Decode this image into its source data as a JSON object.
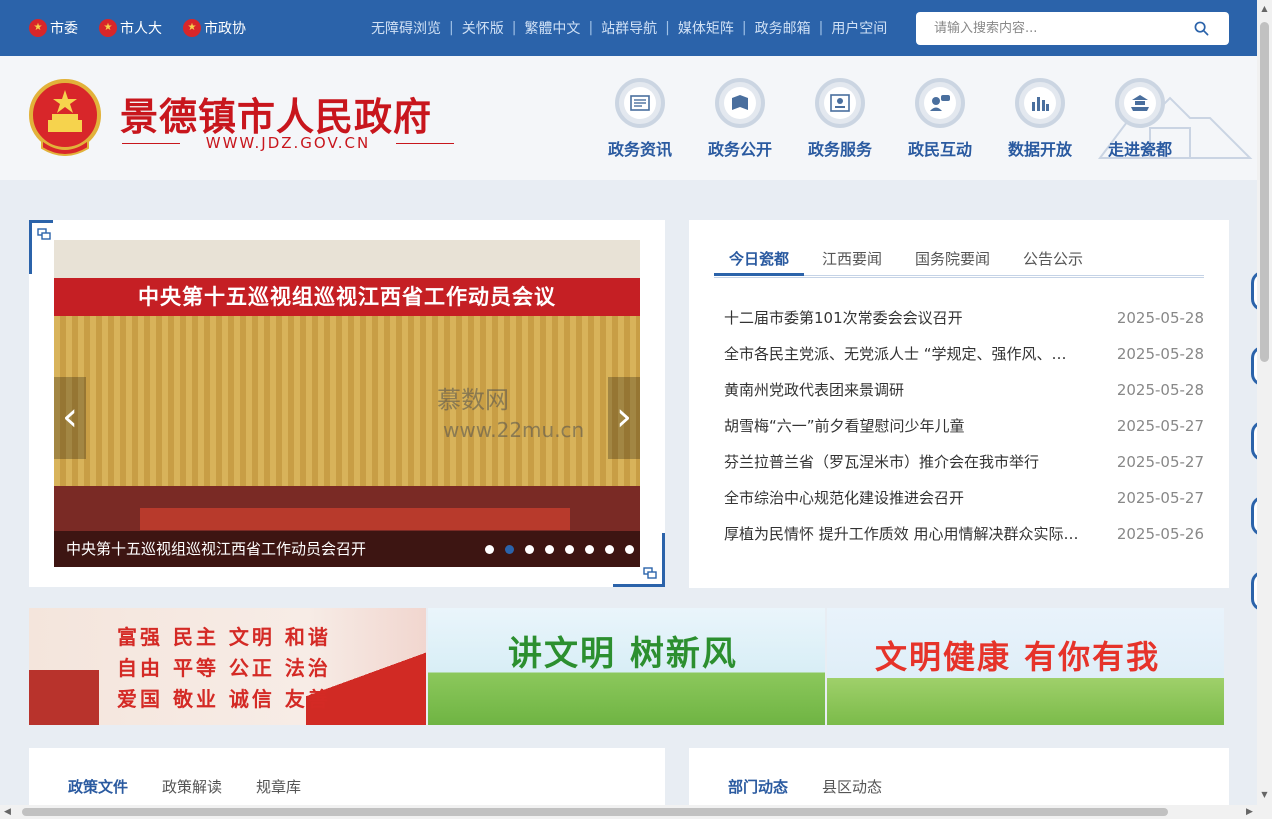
{
  "topbar": {
    "orgs": [
      "市委",
      "市人大",
      "市政协"
    ],
    "links": [
      "无障碍浏览",
      "关怀版",
      "繁體中文",
      "站群导航",
      "媒体矩阵",
      "政务邮箱",
      "用户空间"
    ],
    "search_placeholder": "请输入搜索内容..."
  },
  "header": {
    "title": "景德镇市人民政府",
    "domain": "WWW.JDZ.GOV.CN",
    "nav": [
      "政务资讯",
      "政务公开",
      "政务服务",
      "政民互动",
      "数据开放",
      "走进瓷都"
    ]
  },
  "carousel": {
    "banner_text": "中央第十五巡视组巡视江西省工作动员会议",
    "caption": "中央第十五巡视组巡视江西省工作动员会召开",
    "dot_count": 8,
    "active_dot": 1,
    "prev": "‹",
    "next": "›"
  },
  "watermark": {
    "brand": "慕数网",
    "url": "www.22mu.cn"
  },
  "news": {
    "tabs": [
      "今日瓷都",
      "江西要闻",
      "国务院要闻",
      "公告公示"
    ],
    "active_tab": 0,
    "items": [
      {
        "title": "十二届市委第101次常委会会议召开",
        "date": "2025-05-28"
      },
      {
        "title": "全市各民主党派、无党派人士 “学规定、强作风、…",
        "date": "2025-05-28"
      },
      {
        "title": "黄南州党政代表团来景调研",
        "date": "2025-05-28"
      },
      {
        "title": "胡雪梅“六一”前夕看望慰问少年儿童",
        "date": "2025-05-27"
      },
      {
        "title": "芬兰拉普兰省（罗瓦涅米市）推介会在我市举行",
        "date": "2025-05-27"
      },
      {
        "title": "全市综治中心规范化建设推进会召开",
        "date": "2025-05-27"
      },
      {
        "title": "厚植为民情怀 提升工作质效 用心用情解决群众实际…",
        "date": "2025-05-26"
      }
    ]
  },
  "banners": {
    "values_lines": [
      "富强 民主 文明 和谐",
      "自由 平等 公正 法治",
      "爱国 敬业 诚信 友善"
    ],
    "civility": "讲文明 树新风",
    "health": "文明健康 有你有我"
  },
  "policy": {
    "tabs": [
      "政策文件",
      "政策解读",
      "规章库"
    ]
  },
  "dept": {
    "tabs": [
      "部门动态",
      "县区动态"
    ]
  },
  "colors": {
    "primary": "#2b63aa",
    "brand_red": "#c8161d"
  }
}
